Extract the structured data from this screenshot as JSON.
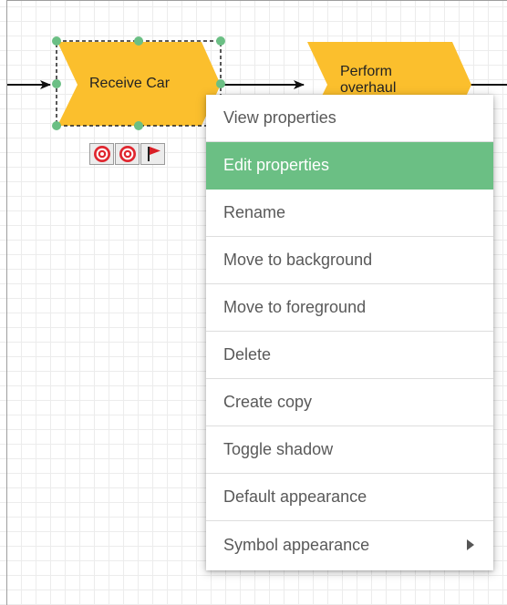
{
  "diagram": {
    "shapes": [
      {
        "label": "Receive Car",
        "state": "selected",
        "fill": "#fbbf2d"
      },
      {
        "label": "Perform overhaul",
        "state": "normal",
        "fill": "#fbbf2d"
      }
    ],
    "selection_color": "#6bbf84",
    "markers": [
      "target-icon",
      "target-icon",
      "red-flag-icon"
    ]
  },
  "context_menu": {
    "items": [
      {
        "label": "View properties"
      },
      {
        "label": "Edit properties",
        "highlighted": true
      },
      {
        "label": "Rename"
      },
      {
        "label": "Move to background"
      },
      {
        "label": "Move to foreground"
      },
      {
        "label": "Delete"
      },
      {
        "label": "Create copy"
      },
      {
        "label": "Toggle shadow"
      },
      {
        "label": "Default appearance"
      },
      {
        "label": "Symbol appearance",
        "has_submenu": true
      }
    ],
    "highlight_color": "#6bbf84"
  }
}
